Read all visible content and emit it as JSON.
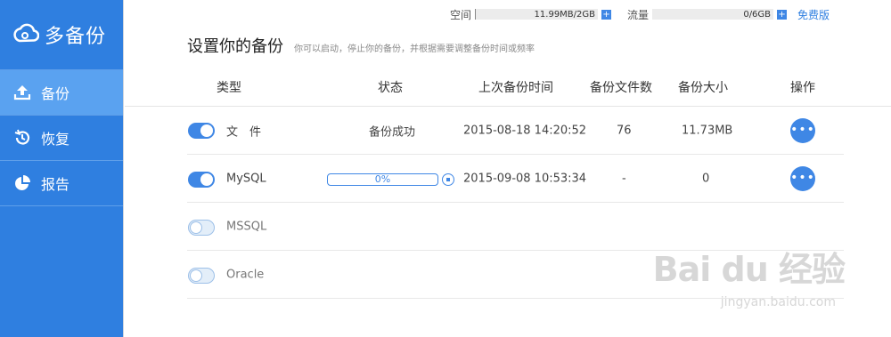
{
  "app": {
    "logo_text": "多备份",
    "logo_icon": "cloud-sync-icon",
    "brand_color": "#2f7fe0"
  },
  "sidebar": {
    "items": [
      {
        "label": "备份",
        "icon": "upload-icon",
        "active": true
      },
      {
        "label": "恢复",
        "icon": "history-icon",
        "active": false
      },
      {
        "label": "报告",
        "icon": "pie-chart-icon",
        "active": false
      }
    ]
  },
  "topbar": {
    "space_label": "空间",
    "space_value": "11.99MB/2GB",
    "traffic_label": "流量",
    "traffic_value": "0/6GB",
    "plus_symbol": "+",
    "free_version": "免费版"
  },
  "header": {
    "title": "设置你的备份",
    "subtitle": "你可以启动，停止你的备份，并根据需要调整备份时间或频率"
  },
  "table": {
    "columns": [
      "类型",
      "状态",
      "上次备份时间",
      "备份文件数",
      "备份大小",
      "操作"
    ],
    "rows": [
      {
        "type": "文　件",
        "enabled": true,
        "status": "备份成功",
        "last_time": "2015-08-18 14:20:52",
        "files": "76",
        "size": "11.73MB",
        "action": "•••"
      },
      {
        "type": "MySQL",
        "enabled": true,
        "status": "0%",
        "last_time": "2015-09-08 10:53:34",
        "files": "-",
        "size": "0",
        "action": "•••"
      },
      {
        "type": "MSSQL",
        "enabled": false
      },
      {
        "type": "Oracle",
        "enabled": false
      }
    ]
  },
  "watermark": {
    "main": "Bai du 经验",
    "sub": "jingyan.baidu.com"
  }
}
